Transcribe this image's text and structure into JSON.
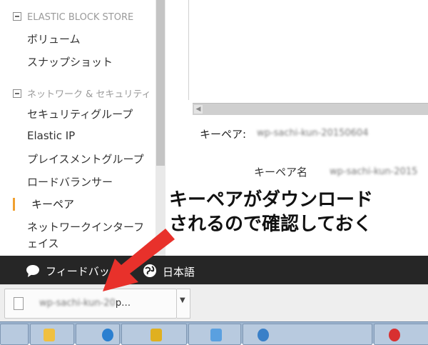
{
  "sidebar": {
    "sections": [
      {
        "title": "ELASTIC BLOCK STORE",
        "items": [
          "ボリューム",
          "スナップショット"
        ]
      },
      {
        "title": "ネットワーク & セキュリティ",
        "items": [
          "セキュリティグループ",
          "Elastic IP",
          "プレイスメントグループ",
          "ロードバランサー",
          "キーペア",
          "ネットワークインターフ",
          "ェイス"
        ]
      }
    ],
    "active_item": "キーペア"
  },
  "detail": {
    "keypair_label": "キーペア:",
    "keypair_value": "wp-sachi-kun-20150604",
    "keypair_name_label": "キーペア名",
    "keypair_name_value": "wp-sachi-kun-2015"
  },
  "annotation": {
    "line1": "キーペアがダウンロード",
    "line2": "されるので確認しておく",
    "arrow_color": "#e8312b"
  },
  "feedback_bar": {
    "feedback_label": "フィードバック",
    "language_label": "日本語"
  },
  "download_bar": {
    "file_name": "wp-sachi-kun-20",
    "file_suffix": "p…"
  },
  "icons": [
    "collapse-icon",
    "chat-bubble-icon",
    "globe-icon",
    "file-icon",
    "caret-down-icon",
    "arrow-left-icon"
  ]
}
